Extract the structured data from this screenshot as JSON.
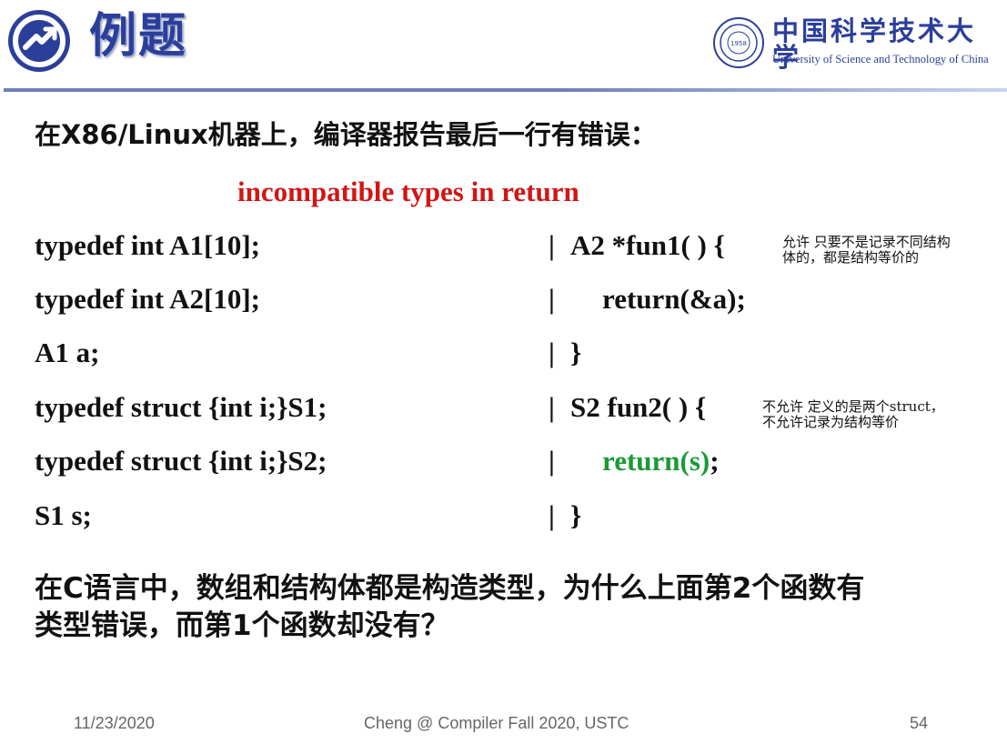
{
  "header": {
    "title": "例题",
    "icon": "arrow-circle-icon",
    "accent_color": "#2b3f9a"
  },
  "logo": {
    "cn": "中国科学技术大学",
    "en": "University of Science and Technology of China",
    "seal_year": "1958"
  },
  "question": "在X86/Linux机器上，编译器报告最后一行有错误：",
  "error_message": "incompatible types in return",
  "code_left": [
    "typedef int A1[10];",
    "typedef int A2[10];",
    "A1 a;",
    "typedef struct {int i;}S1;",
    "typedef struct {int i;}S2;",
    "S1 s;"
  ],
  "code_right": [
    {
      "bar": "|",
      "pre": "A2 *fun1( ) {",
      "hl": "",
      "post": ""
    },
    {
      "bar": "|",
      "pre": "return(&a);",
      "hl": "",
      "post": ""
    },
    {
      "bar": "|",
      "pre": "}",
      "hl": "",
      "post": ""
    },
    {
      "bar": "|",
      "pre": "S2  fun2( ) {",
      "hl": "",
      "post": ""
    },
    {
      "bar": "|",
      "pre": "",
      "hl": "return(s)",
      "post": ";"
    },
    {
      "bar": "|",
      "pre": "}",
      "hl": "",
      "post": ""
    }
  ],
  "notes": {
    "fun1": [
      "允许 只要不是记录不同结构",
      "体的，都是结构等价的"
    ],
    "fun2": [
      "不允许 定义的是两个struct，",
      "不允许记录为结构等价"
    ]
  },
  "final_question": [
    "在C语言中，数组和结构体都是构造类型，为什么上面第2个函数有",
    "类型错误，而第1个函数却没有？"
  ],
  "footer": {
    "date": "11/23/2020",
    "center": "Cheng @ Compiler Fall 2020, USTC",
    "page": "54"
  },
  "colors": {
    "error": "#d21515",
    "highlight": "#1a9a36"
  }
}
